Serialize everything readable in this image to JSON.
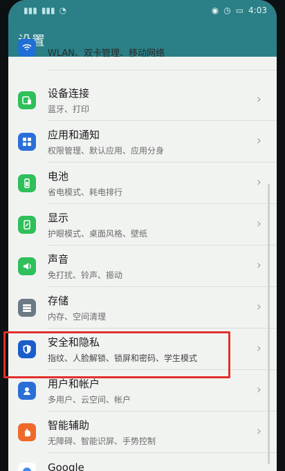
{
  "status": {
    "time": "4:03"
  },
  "title": "设置",
  "items": [
    {
      "title": "",
      "subtitle": "WLAN、双卡管理、移动网络",
      "icon": "wifi-icon",
      "color": "#1f6fd6"
    },
    {
      "title": "设备连接",
      "subtitle": "蓝牙、打印",
      "icon": "device-connect-icon",
      "color": "#2fbf5b"
    },
    {
      "title": "应用和通知",
      "subtitle": "权限管理、默认应用、应用分身",
      "icon": "apps-icon",
      "color": "#2a6fd8"
    },
    {
      "title": "电池",
      "subtitle": "省电模式、耗电排行",
      "icon": "battery-icon",
      "color": "#2fbf5b"
    },
    {
      "title": "显示",
      "subtitle": "护眼模式、桌面风格、壁纸",
      "icon": "display-icon",
      "color": "#2fbf5b"
    },
    {
      "title": "声音",
      "subtitle": "免打扰、铃声、振动",
      "icon": "sound-icon",
      "color": "#2fbf5b"
    },
    {
      "title": "存储",
      "subtitle": "内存、空间清理",
      "icon": "storage-icon",
      "color": "#6c7a86"
    },
    {
      "title": "安全和隐私",
      "subtitle": "指纹、人脸解锁、锁屏和密码、学生模式",
      "icon": "security-shield-icon",
      "color": "#1b5ec9"
    },
    {
      "title": "用户和帐户",
      "subtitle": "多用户、云空间、帐户",
      "icon": "user-icon",
      "color": "#2a6fd8"
    },
    {
      "title": "智能辅助",
      "subtitle": "无障碍、智能识屏、手势控制",
      "icon": "hand-icon",
      "color": "#ef6a2a"
    },
    {
      "title": "Google",
      "subtitle": "",
      "icon": "google-icon",
      "color": "#ffffff"
    }
  ]
}
